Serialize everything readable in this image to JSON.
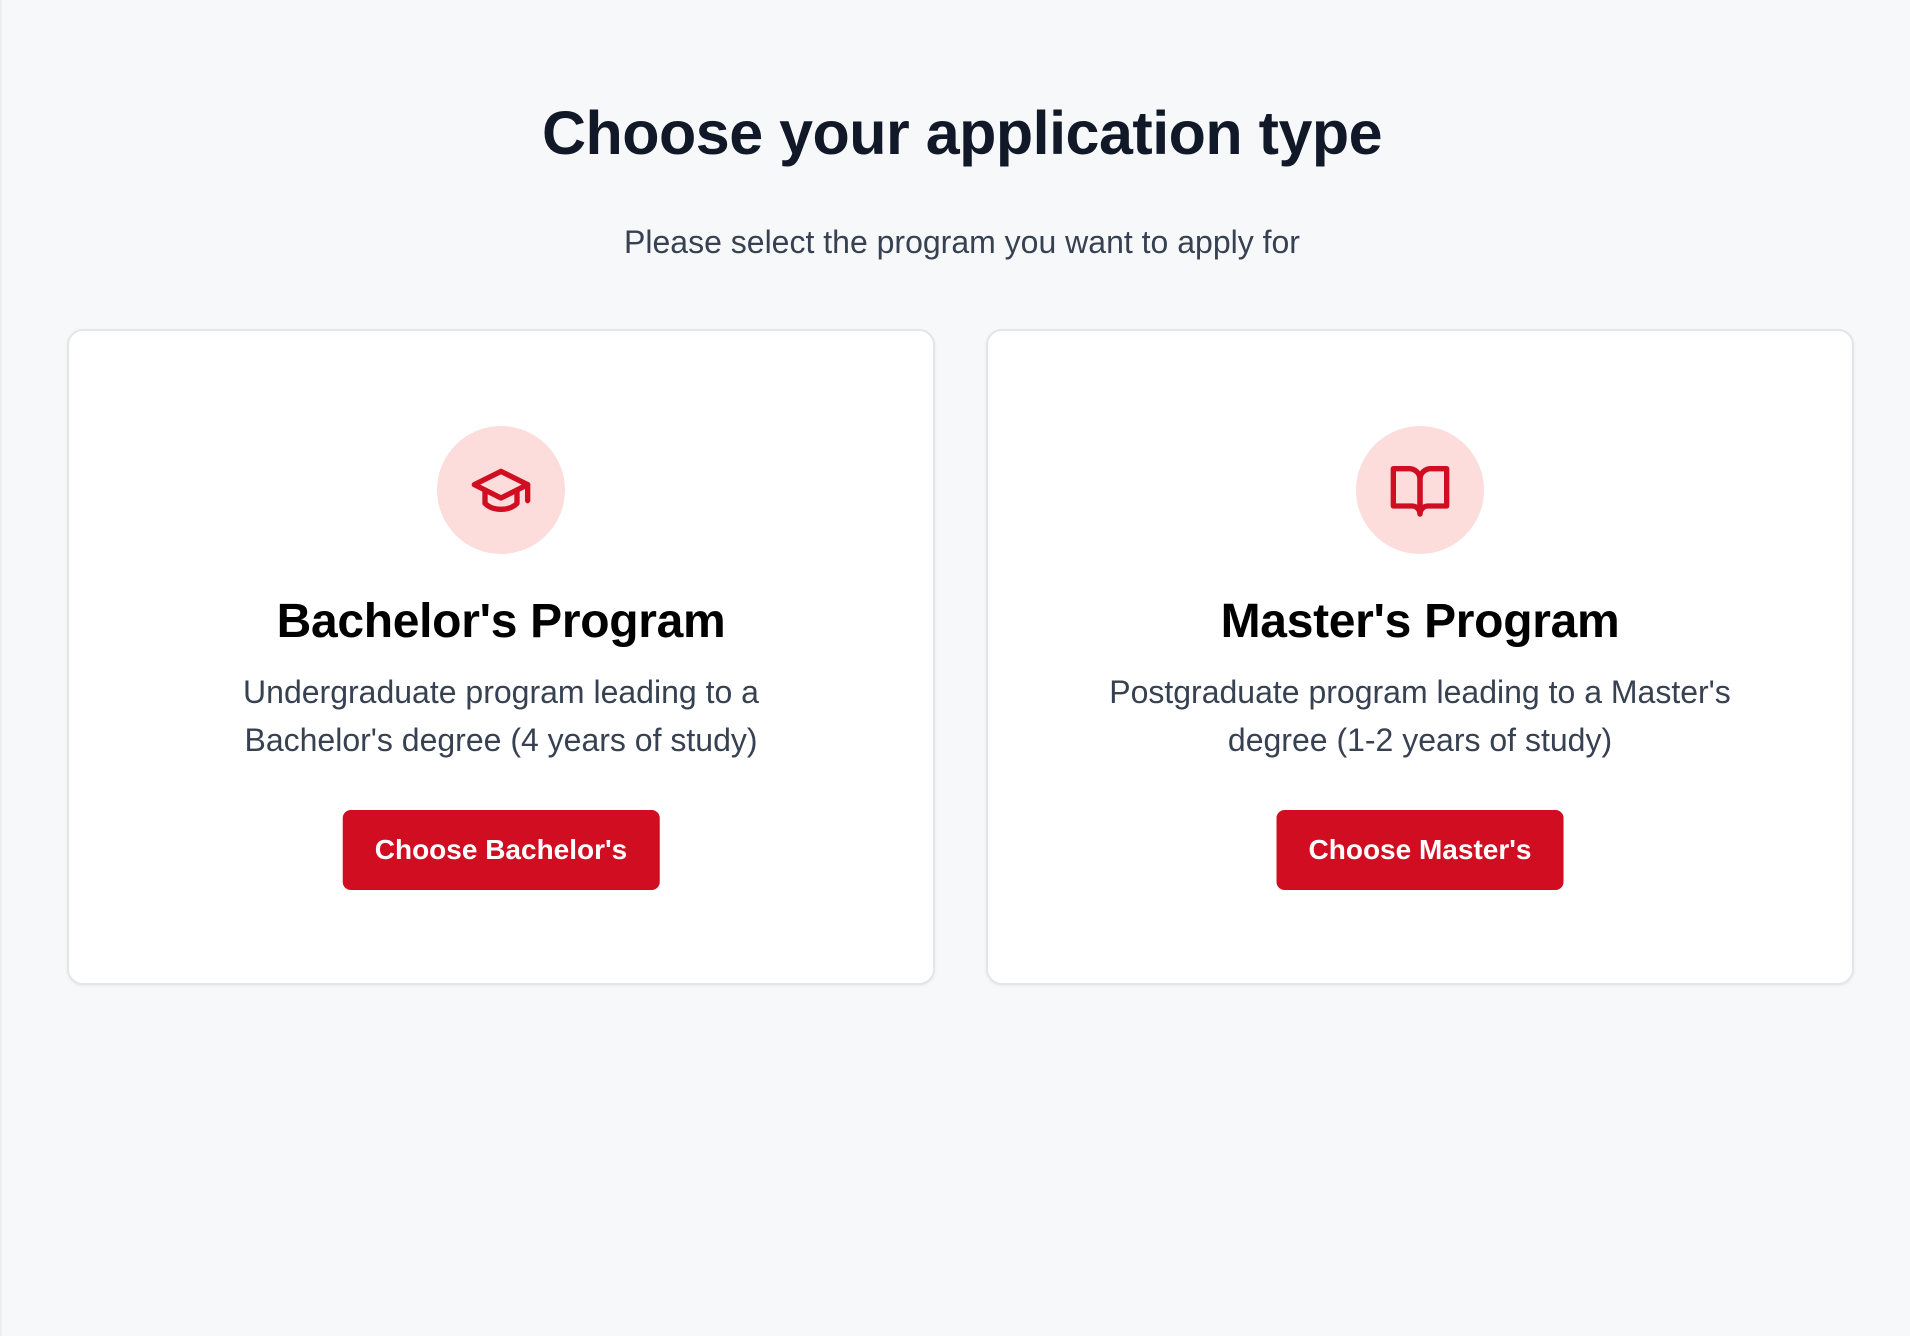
{
  "header": {
    "title": "Choose your application type",
    "subtitle": "Please select the program you want to apply for"
  },
  "accent_color": "#d10d21",
  "icon_bg_color": "#fddcdc",
  "programs": [
    {
      "icon": "graduation-cap-icon",
      "title": "Bachelor's Program",
      "description": "Undergraduate program leading to a Bachelor's degree (4 years of study)",
      "button_label": "Choose Bachelor's"
    },
    {
      "icon": "book-open-icon",
      "title": "Master's Program",
      "description": "Postgraduate program leading to a Master's degree (1-2 years of study)",
      "button_label": "Choose Master's"
    }
  ]
}
